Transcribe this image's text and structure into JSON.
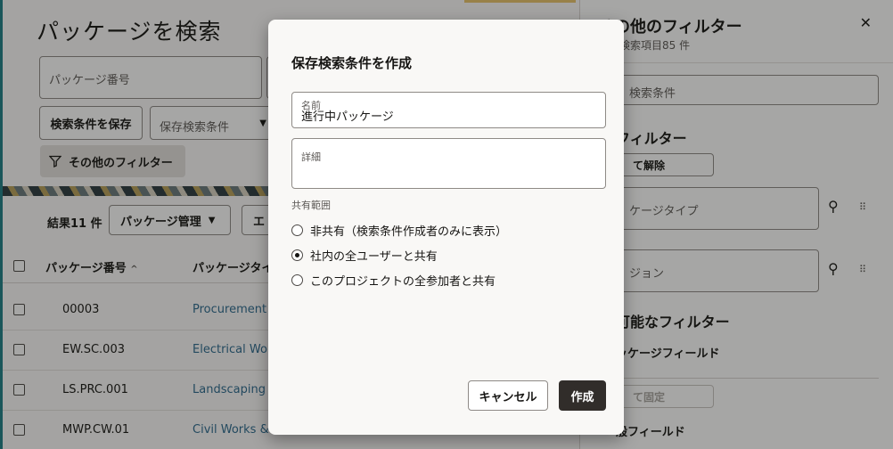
{
  "page": {
    "title": "パッケージを検索",
    "package_number_placeholder": "パッケージ番号",
    "save_search_button": "検索条件を保存",
    "saved_search_placeholder": "保存検索条件",
    "more_filters_button": "その他のフィルター",
    "results_count": "結果11 件",
    "package_mgmt_button": "パッケージ管理",
    "export_button": "エ",
    "columns": {
      "package_number": "パッケージ番号",
      "package_type": "パッケージタイ"
    },
    "rows": [
      {
        "number": "00003",
        "type": "Procurement"
      },
      {
        "number": "EW.SC.003",
        "type": "Electrical Work"
      },
      {
        "number": "LS.PRC.001",
        "type": "Landscaping W"
      },
      {
        "number": "MWP.CW.01",
        "type": "Civil Works & Ir"
      }
    ]
  },
  "side_panel": {
    "title": "その他のフィルター",
    "subtitle": "能な検索項目85 件",
    "search_placeholder": "検索条件",
    "filters_heading": "フィルター",
    "clear_all_button": "て解除",
    "field_package_type": "ケージタイプ",
    "field_version": "ジョン",
    "available_heading": "可能なフィルター",
    "package_fields_heading": "ッケージフィールド",
    "pin_all_button": "て固定",
    "general_fields_heading": "般フィールド"
  },
  "dialog": {
    "title": "保存検索条件を作成",
    "name_label": "名前",
    "name_value": "進行中パッケージ",
    "details_label": "詳細",
    "share_label": "共有範囲",
    "options": [
      "非共有（検索条件作成者のみに表示）",
      "社内の全ユーザーと共有",
      "このプロジェクトの全参加者と共有"
    ],
    "selected_option_index": 1,
    "cancel_button": "キャンセル",
    "create_button": "作成"
  },
  "colors": {
    "accent_teal": "#1e7f86",
    "link": "#2c6a8f",
    "primary_button": "#312d2a"
  },
  "icons": {
    "filter": "funnel-icon",
    "close": "close-icon",
    "sort": "sort-ascending-icon",
    "pin": "pin-off-icon",
    "drag": "drag-handle-icon"
  }
}
